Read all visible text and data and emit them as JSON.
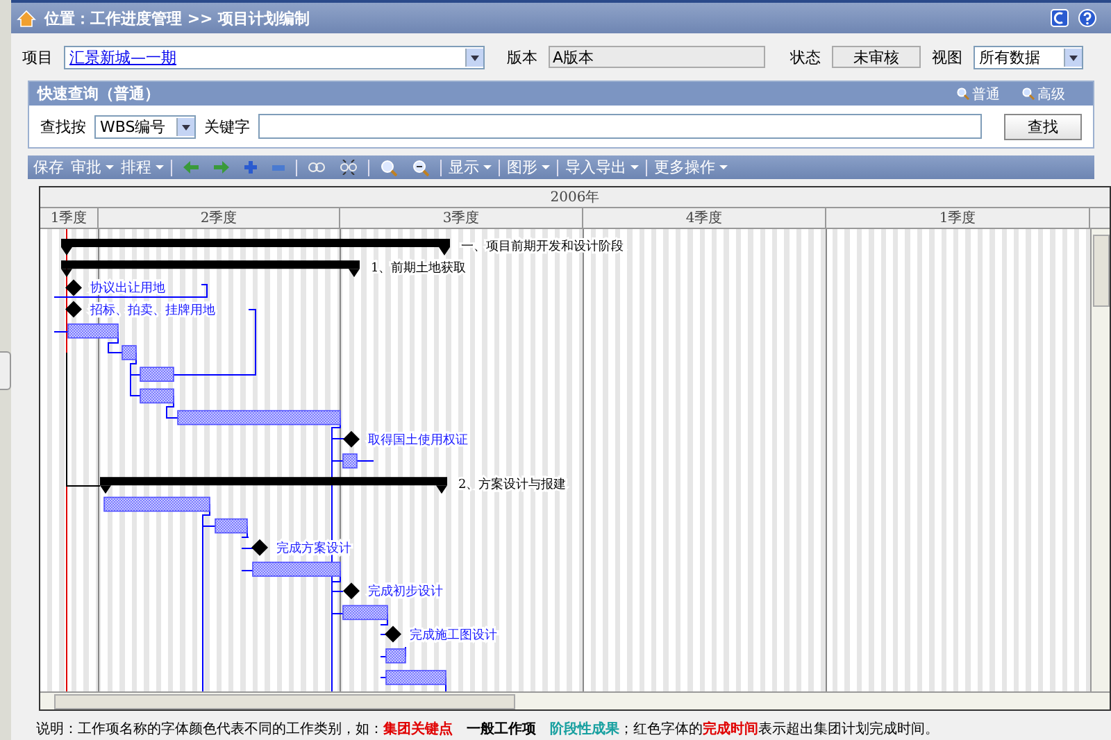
{
  "header": {
    "breadcrumb": "位置：工作进度管理 >> 项目计划编制"
  },
  "form": {
    "project_label": "项目",
    "project_value": "汇景新城—一期",
    "version_label": "版本",
    "version_value": "A版本",
    "status_label": "状态",
    "status_value": "未审核",
    "view_label": "视图",
    "view_value": "所有数据"
  },
  "quick_search": {
    "title": "快速查询（普通）",
    "links": [
      "普通",
      "高级"
    ],
    "find_by_label": "查找按",
    "find_by_value": "WBS编号",
    "keyword_label": "关键字",
    "search_button": "查找"
  },
  "toolbar": {
    "left": [
      {
        "label": "保存",
        "menu": false
      },
      {
        "label": "审批",
        "menu": true
      },
      {
        "label": "排程",
        "menu": true
      }
    ],
    "right": [
      {
        "label": "显示",
        "menu": true
      },
      {
        "label": "图形",
        "menu": true
      },
      {
        "label": "导入导出",
        "menu": true
      },
      {
        "label": "更多操作",
        "menu": true
      }
    ]
  },
  "gantt": {
    "year": "2006年",
    "quarters": [
      "1季度",
      "2季度",
      "3季度",
      "4季度",
      "1季度"
    ],
    "tasks": [
      {
        "kind": "summary",
        "name": "一、项目前期开发和设计阶段"
      },
      {
        "kind": "summary",
        "name": "1、前期土地获取"
      },
      {
        "kind": "milestone",
        "name": "协议出让用地"
      },
      {
        "kind": "milestone",
        "name": "招标、拍卖、挂牌用地"
      },
      {
        "kind": "task"
      },
      {
        "kind": "task"
      },
      {
        "kind": "task"
      },
      {
        "kind": "task"
      },
      {
        "kind": "task"
      },
      {
        "kind": "milestone",
        "name": "取得国土使用权证"
      },
      {
        "kind": "task"
      },
      {
        "kind": "summary",
        "name": "2、方案设计与报建"
      },
      {
        "kind": "task"
      },
      {
        "kind": "task"
      },
      {
        "kind": "milestone",
        "name": "完成方案设计"
      },
      {
        "kind": "task"
      },
      {
        "kind": "milestone",
        "name": "完成初步设计"
      },
      {
        "kind": "task"
      },
      {
        "kind": "milestone",
        "name": "完成施工图设计"
      },
      {
        "kind": "task"
      },
      {
        "kind": "task"
      }
    ]
  },
  "legend": [
    {
      "kind": "plain",
      "text": "说明：工作项名称的字体颜色代表不同的工作类别，如："
    },
    {
      "kind": "key",
      "text": "集团关键点"
    },
    {
      "kind": "normal",
      "text": "一般工作项"
    },
    {
      "kind": "phase",
      "text": "阶段性成果"
    },
    {
      "kind": "plain",
      "text": "；红色字体的"
    },
    {
      "kind": "overdue",
      "text": "完成时间"
    },
    {
      "kind": "plain",
      "text": "表示超出集团计划完成时间。"
    }
  ]
}
